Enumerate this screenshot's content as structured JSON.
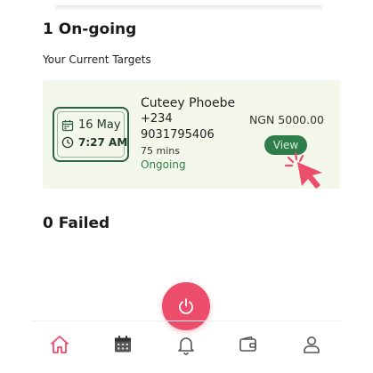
{
  "ongoing": {
    "title": "1 On-going",
    "subtitle": "Your Current Targets"
  },
  "target": {
    "date": "16 May",
    "time": "7:27 AM",
    "name": "Cuteey Phoebe",
    "phone_prefix": "+234",
    "phone_number": "9031795406",
    "duration": "75 mins",
    "status": "Ongoing",
    "amount": "NGN 5000.00",
    "view_label": "View"
  },
  "failed": {
    "title": "0 Failed"
  },
  "nav": {
    "items": [
      "home-icon",
      "calendar-icon",
      "bell-icon",
      "wallet-icon",
      "profile-icon"
    ],
    "active": "home-icon"
  },
  "colors": {
    "accent_pink": "#ec4d6a",
    "accent_green": "#2e7d4b",
    "card_bg": "#f4f8ea"
  },
  "icons": {
    "fab": "power-icon",
    "date": "calendar-small-icon",
    "time": "clock-icon"
  }
}
